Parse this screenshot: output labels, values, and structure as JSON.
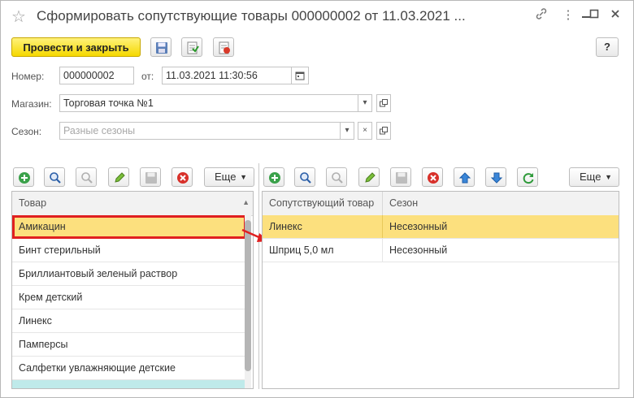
{
  "window": {
    "title": "Сформировать сопутствующие товары 000000002 от 11.03.2021 ...",
    "icons": [
      "star-icon",
      "link-icon",
      "more-vertical-icon",
      "minimize-icon",
      "maximize-icon",
      "close-icon"
    ]
  },
  "toolbar": {
    "primary_label": "Провести и закрыть",
    "icons": [
      "save-icon",
      "post-icon",
      "print-icon"
    ],
    "help_label": "?"
  },
  "form": {
    "number_label": "Номер:",
    "number_value": "000000002",
    "date_label": "от:",
    "date_value": "11.03.2021 11:30:56",
    "store_label": "Магазин:",
    "store_value": "Торговая точка №1",
    "season_label": "Сезон:",
    "season_placeholder": "Разные сезоны"
  },
  "left_panel": {
    "more_label": "Еще",
    "column": "Товар",
    "rows": [
      "Амикацин",
      "Бинт стерильный",
      "Бриллиантовый зеленый раствор",
      "Крем детский",
      "Линекс",
      "Памперсы",
      "Салфетки увлажняющие детские"
    ],
    "selected_index": 0
  },
  "right_panel": {
    "more_label": "Еще",
    "columns": [
      "Сопутствующий товар",
      "Сезон"
    ],
    "rows": [
      {
        "product": "Линекс",
        "season": "Несезонный"
      },
      {
        "product": "Шприц 5,0 мл",
        "season": "Несезонный"
      }
    ],
    "selected_index": 0
  },
  "colors": {
    "accent_yellow": "#f5d800",
    "selection": "#fce07e",
    "highlight_red": "#e02020"
  }
}
